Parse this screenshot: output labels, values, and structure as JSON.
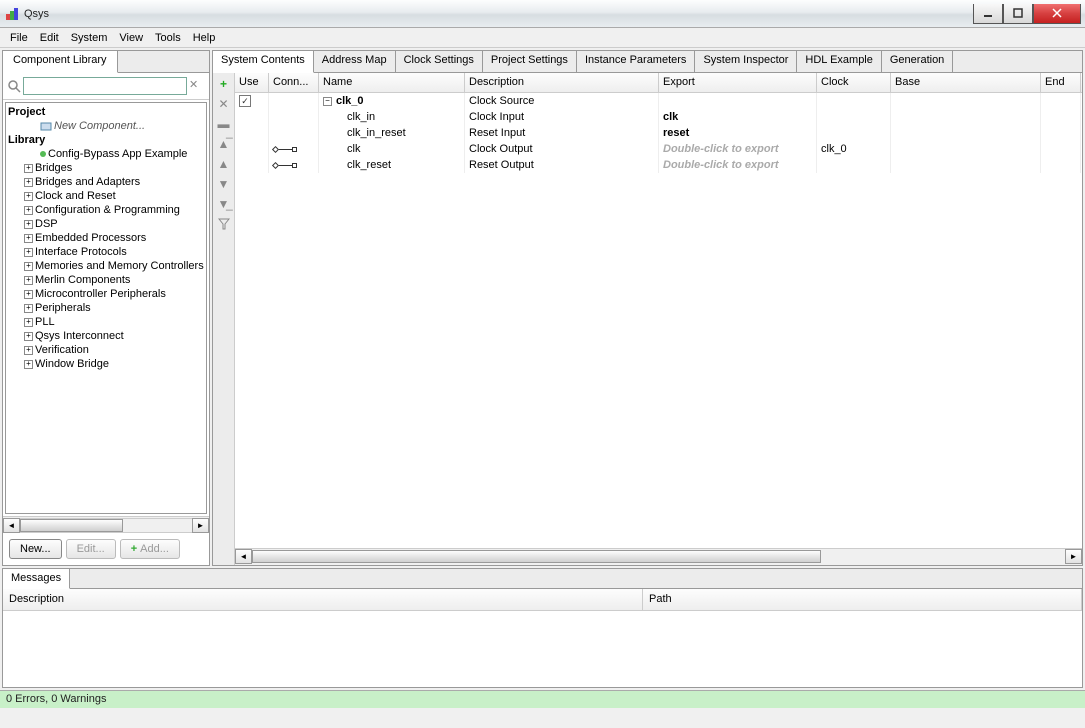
{
  "window": {
    "title": "Qsys"
  },
  "menu": [
    "File",
    "Edit",
    "System",
    "View",
    "Tools",
    "Help"
  ],
  "left_panel": {
    "tab": "Component Library",
    "search_placeholder": "",
    "tree": {
      "project_header": "Project",
      "new_component": "New Component...",
      "library_header": "Library",
      "config_bypass": "Config-Bypass App Example",
      "items": [
        "Bridges",
        "Bridges and Adapters",
        "Clock and Reset",
        "Configuration & Programming",
        "DSP",
        "Embedded Processors",
        "Interface Protocols",
        "Memories and Memory Controllers",
        "Merlin Components",
        "Microcontroller Peripherals",
        "Peripherals",
        "PLL",
        "Qsys Interconnect",
        "Verification",
        "Window Bridge"
      ]
    },
    "buttons": {
      "new": "New...",
      "edit": "Edit...",
      "add": "Add..."
    }
  },
  "tabs": [
    "System Contents",
    "Address Map",
    "Clock Settings",
    "Project Settings",
    "Instance Parameters",
    "System Inspector",
    "HDL Example",
    "Generation"
  ],
  "grid": {
    "headers": [
      "Use",
      "Conn...",
      "Name",
      "Description",
      "Export",
      "Clock",
      "Base",
      "End"
    ],
    "rows": [
      {
        "use_checked": true,
        "name": "clk_0",
        "bold": true,
        "desc": "Clock Source",
        "export": "",
        "clock": "",
        "has_minus": true
      },
      {
        "name": "clk_in",
        "child": true,
        "desc": "Clock Input",
        "export": "clk",
        "export_bold": true,
        "clock": ""
      },
      {
        "name": "clk_in_reset",
        "child": true,
        "desc": "Reset Input",
        "export": "reset",
        "export_bold": true,
        "clock": ""
      },
      {
        "name": "clk",
        "child": true,
        "conn": true,
        "desc": "Clock Output",
        "export": "Double-click to export",
        "export_hint": true,
        "clock": "clk_0"
      },
      {
        "name": "clk_reset",
        "child": true,
        "conn": true,
        "desc": "Reset Output",
        "export": "Double-click to export",
        "export_hint": true,
        "clock": ""
      }
    ]
  },
  "messages": {
    "tab": "Messages",
    "headers": {
      "desc": "Description",
      "path": "Path"
    }
  },
  "status": "0 Errors, 0 Warnings"
}
